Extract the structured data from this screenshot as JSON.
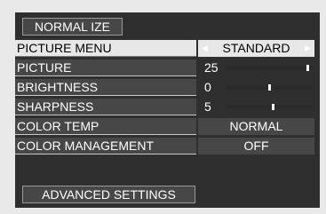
{
  "top_button": "NORMAL IZE",
  "bottom_button": "ADVANCED SETTINGS",
  "menu": [
    {
      "label": "PICTURE MENU",
      "type": "select",
      "value": "STANDARD",
      "selected": true
    },
    {
      "label": "PICTURE",
      "type": "slider",
      "value": "25",
      "level": 1.0
    },
    {
      "label": "BRIGHTNESS",
      "type": "slider",
      "value": "0",
      "level": 0.5
    },
    {
      "label": "SHARPNESS",
      "type": "slider",
      "value": "5",
      "level": 0.55
    },
    {
      "label": "COLOR TEMP",
      "type": "select",
      "value": "NORMAL"
    },
    {
      "label": "COLOR MANAGEMENT",
      "type": "select",
      "value": "OFF"
    }
  ],
  "colors": {
    "panel": "#2f2f2f",
    "row": "#474747",
    "highlight": "#e7e7e7",
    "text": "#ffffff"
  }
}
